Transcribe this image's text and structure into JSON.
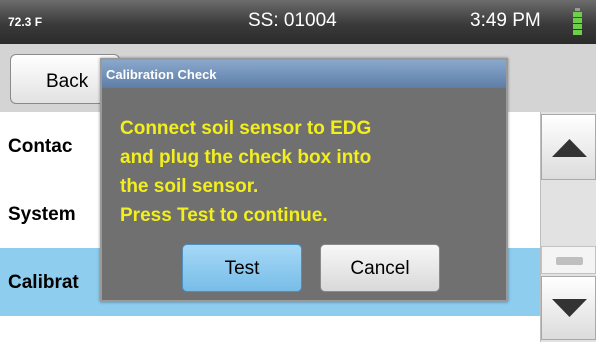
{
  "status_bar": {
    "temperature": "72.3 F",
    "serial": "SS: 01004",
    "time": "3:49 PM",
    "battery_icon": "battery-full-icon"
  },
  "toolbar": {
    "back_label": "Back"
  },
  "list": {
    "items": [
      {
        "label": "Contac"
      },
      {
        "label": "System"
      },
      {
        "label": "Calibrat",
        "selected": true
      }
    ]
  },
  "scrollbar": {
    "up_icon": "triangle-up-icon",
    "down_icon": "triangle-down-icon"
  },
  "dialog": {
    "title": "Calibration Check",
    "message_lines": [
      "Connect soil sensor to EDG",
      "and plug the check box into",
      "the soil sensor.",
      "Press Test to continue."
    ],
    "test_label": "Test",
    "cancel_label": "Cancel"
  },
  "colors": {
    "message_text": "#f2ef1c",
    "selected_row": "#8fcdee",
    "dialog_bg": "#707070",
    "battery": "#6fcf4a"
  }
}
